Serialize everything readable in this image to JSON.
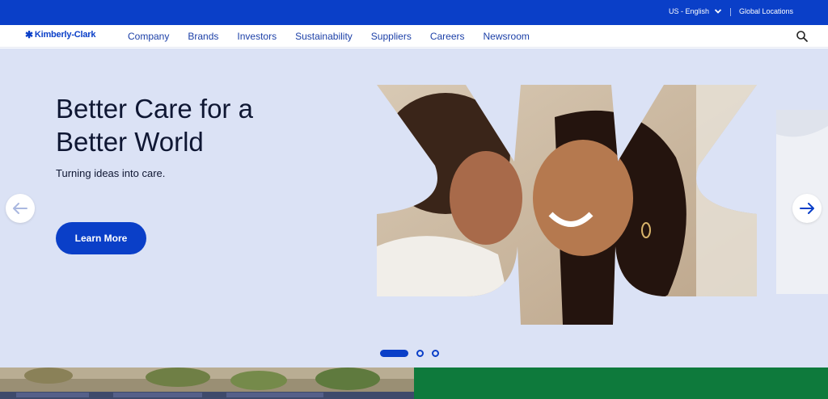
{
  "utility_bar": {
    "locale_label": "US - English",
    "global_label": "Global Locations"
  },
  "brand": {
    "logo_text": "Kimberly-Clark"
  },
  "nav": {
    "items": [
      "Company",
      "Brands",
      "Investors",
      "Sustainability",
      "Suppliers",
      "Careers",
      "Newsroom"
    ]
  },
  "hero": {
    "title": "Better Care for a Better World",
    "subtitle": "Turning ideas into care.",
    "cta_label": "Learn More"
  },
  "carousel": {
    "slide_count": 3,
    "active_index": 0
  },
  "colors": {
    "brand_blue": "#0a3fc8",
    "hero_bg": "#dbe2f5",
    "panel_green": "#0e7a3c"
  },
  "icons": {
    "search": "search-icon",
    "locale_chevron": "chevron-down-icon",
    "prev": "arrow-left-icon",
    "next": "arrow-right-icon"
  }
}
